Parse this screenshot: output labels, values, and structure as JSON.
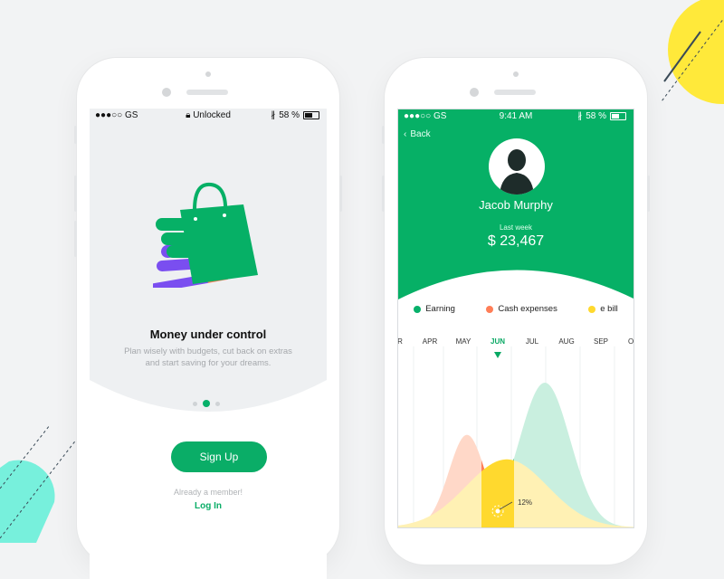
{
  "phone1": {
    "status": {
      "carrier": "●●●○○ GS",
      "center": "Unlocked",
      "battery": "58 %"
    },
    "title": "Money under control",
    "description_line1": "Plan wisely with budgets, cut back on extras",
    "description_line2": "and start saving for your dreams.",
    "signup_label": "Sign Up",
    "member_text": "Already a member!",
    "login_label": "Log In",
    "pager_index": 2,
    "pager_total": 3
  },
  "phone2": {
    "status": {
      "carrier": "●●●○○ GS",
      "time": "9:41 AM",
      "battery": "58 %"
    },
    "back_label": "Back",
    "user_name": "Jacob Murphy",
    "period_label": "Last week",
    "amount": "$ 23,467",
    "legend": [
      {
        "label": "Earning",
        "color": "#07b06a"
      },
      {
        "label": "Cash expenses",
        "color": "#ff7e57"
      },
      {
        "label": "e bill",
        "color": "#ffd92e"
      }
    ],
    "chart_data": {
      "type": "area",
      "categories": [
        "R",
        "APR",
        "MAY",
        "JUN",
        "JUL",
        "AUG",
        "SEP",
        "OC"
      ],
      "selected": "JUN",
      "series": [
        {
          "name": "Earning",
          "values": [
            0,
            0,
            0,
            45,
            100,
            50,
            0,
            0
          ]
        },
        {
          "name": "Cash expenses",
          "values": [
            0,
            18,
            62,
            0,
            0,
            0,
            0,
            0
          ]
        },
        {
          "name": "e bill",
          "values": [
            0,
            8,
            40,
            47,
            42,
            22,
            3,
            0
          ]
        }
      ],
      "annotation": "12%"
    }
  },
  "colors": {
    "green": "#06b066",
    "orange": "#ff7e57",
    "yellow": "#ffd92e",
    "teal": "#78f0dc"
  }
}
